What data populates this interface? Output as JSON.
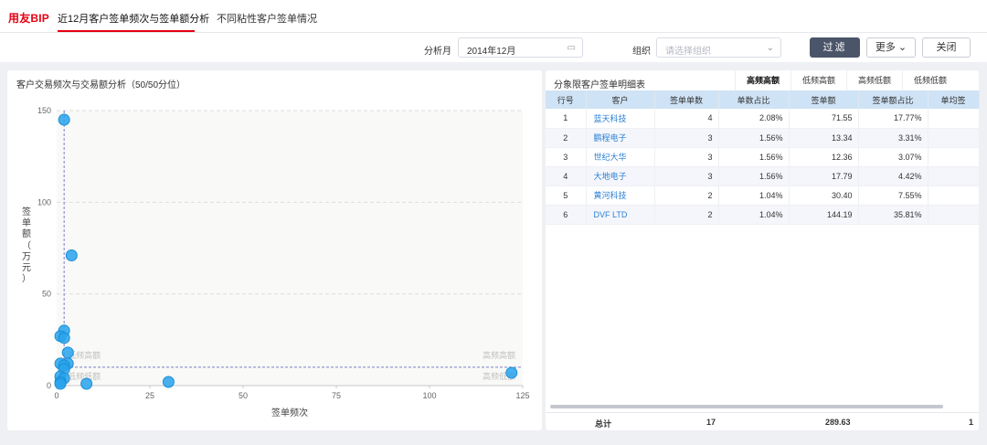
{
  "header": {
    "logo": "用友BIP",
    "tabs": [
      {
        "label": "近12月客户签单频次与签单额分析",
        "active": true
      },
      {
        "label": "不同粘性客户签单情况",
        "active": false
      }
    ]
  },
  "filters": {
    "month_label": "分析月",
    "month_value": "2014年12月",
    "org_label": "组织",
    "org_placeholder": "请选择组织",
    "filter_btn": "过滤",
    "more_btn": "更多",
    "close_btn": "关闭"
  },
  "chart_panel": {
    "title": "客户交易频次与交易额分析（50/50分位）"
  },
  "chart_data": {
    "type": "scatter",
    "xlabel": "签单频次",
    "ylabel": "签单额（万元）",
    "xlim": [
      0,
      125
    ],
    "ylim": [
      0,
      150
    ],
    "xticks": [
      0,
      25,
      50,
      75,
      100,
      125
    ],
    "yticks": [
      0,
      50,
      100,
      150
    ],
    "x_split": 2,
    "y_split": 10,
    "quadrant_labels": [
      "低频高额",
      "高频高额",
      "低频低额",
      "高频低额"
    ],
    "points": [
      {
        "x": 2,
        "y": 145
      },
      {
        "x": 4,
        "y": 71
      },
      {
        "x": 2,
        "y": 30
      },
      {
        "x": 1,
        "y": 27
      },
      {
        "x": 2,
        "y": 26
      },
      {
        "x": 3,
        "y": 18
      },
      {
        "x": 3,
        "y": 12
      },
      {
        "x": 1,
        "y": 12
      },
      {
        "x": 2,
        "y": 11
      },
      {
        "x": 2,
        "y": 9
      },
      {
        "x": 1,
        "y": 5
      },
      {
        "x": 2,
        "y": 4
      },
      {
        "x": 1,
        "y": 2
      },
      {
        "x": 1,
        "y": 1
      },
      {
        "x": 8,
        "y": 1
      },
      {
        "x": 30,
        "y": 2
      },
      {
        "x": 122,
        "y": 7
      }
    ]
  },
  "table_panel": {
    "title": "分象限客户签单明细表",
    "tabs": [
      "高频高额",
      "低频高额",
      "高频低额",
      "低频低额"
    ],
    "columns": [
      "行号",
      "客户",
      "签单单数",
      "单数占比",
      "签单额",
      "签单额占比",
      "单均签"
    ],
    "rows": [
      {
        "no": "1",
        "customer": "蓝天科技",
        "count": "4",
        "count_pct": "2.08%",
        "amount": "71.55",
        "amount_pct": "17.77%"
      },
      {
        "no": "2",
        "customer": "鹏程电子",
        "count": "3",
        "count_pct": "1.56%",
        "amount": "13.34",
        "amount_pct": "3.31%"
      },
      {
        "no": "3",
        "customer": "世纪大华",
        "count": "3",
        "count_pct": "1.56%",
        "amount": "12.36",
        "amount_pct": "3.07%"
      },
      {
        "no": "4",
        "customer": "大地电子",
        "count": "3",
        "count_pct": "1.56%",
        "amount": "17.79",
        "amount_pct": "4.42%"
      },
      {
        "no": "5",
        "customer": "黄河科技",
        "count": "2",
        "count_pct": "1.04%",
        "amount": "30.40",
        "amount_pct": "7.55%"
      },
      {
        "no": "6",
        "customer": "DVF LTD",
        "count": "2",
        "count_pct": "1.04%",
        "amount": "144.19",
        "amount_pct": "35.81%"
      }
    ],
    "totals": {
      "label": "总计",
      "count": "17",
      "amount": "289.63",
      "avg": "1"
    }
  },
  "colors": {
    "accent": "#e60012",
    "point": "#29a3ec",
    "table_header": "#cfe3f6",
    "link": "#2a7fd4"
  }
}
